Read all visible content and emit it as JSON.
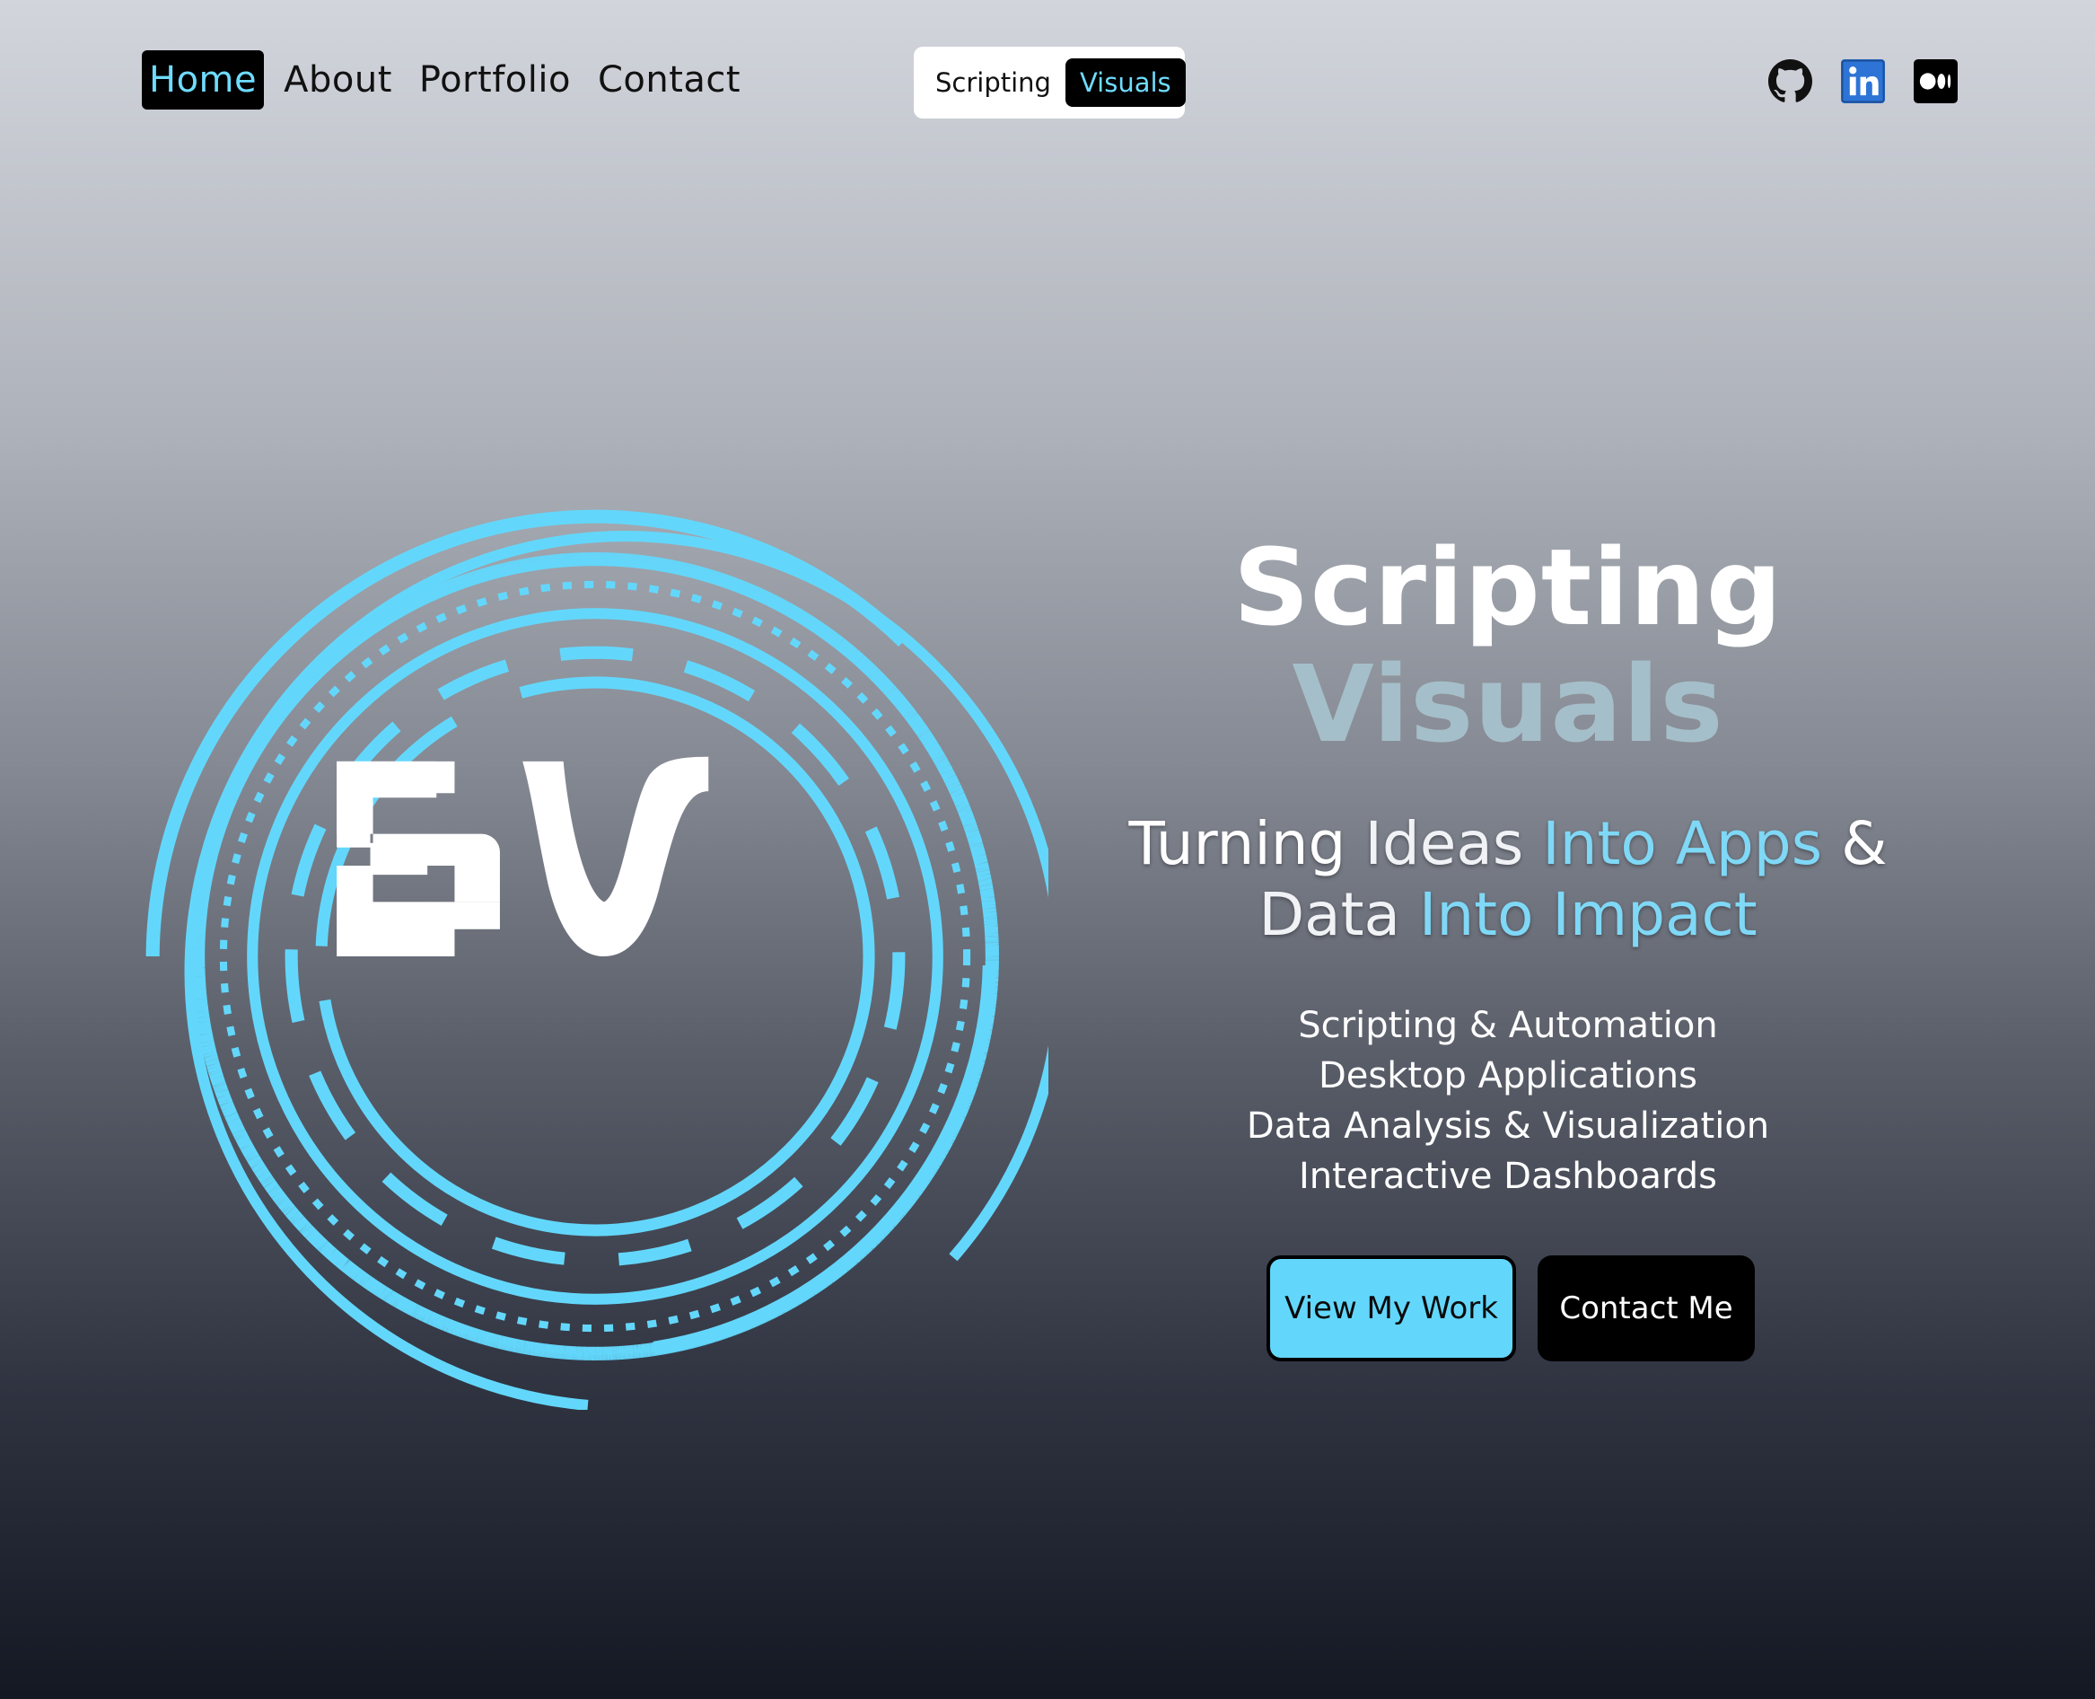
{
  "nav": {
    "links": [
      {
        "label": "Home",
        "active": true
      },
      {
        "label": "About"
      },
      {
        "label": "Portfolio"
      },
      {
        "label": "Contact"
      }
    ]
  },
  "theme_toggle": {
    "options": [
      "Scripting",
      "Visuals"
    ],
    "selected": "Visuals"
  },
  "socials": [
    "github-icon",
    "linkedin-icon",
    "medium-icon"
  ],
  "logo": {
    "monogram": "SV",
    "accent": "#63d7fb"
  },
  "hero": {
    "brand_word_1": "Scripting",
    "brand_word_2": "Visuals",
    "tagline": {
      "part1": "Turning",
      "part2": "Ideas",
      "part3": "Into Apps",
      "part4": "&",
      "part5": "Data",
      "part6": "Into Impact"
    },
    "services": [
      "Scripting & Automation",
      "Desktop Applications",
      "Data Analysis & Visualization",
      "Interactive Dashboards"
    ],
    "primary_button": "View My Work",
    "secondary_button": "Contact Me"
  },
  "colors": {
    "accent": "#63d7fb",
    "highlight_text": "#7fd8f6",
    "brand_secondary": "#a5bfca"
  }
}
